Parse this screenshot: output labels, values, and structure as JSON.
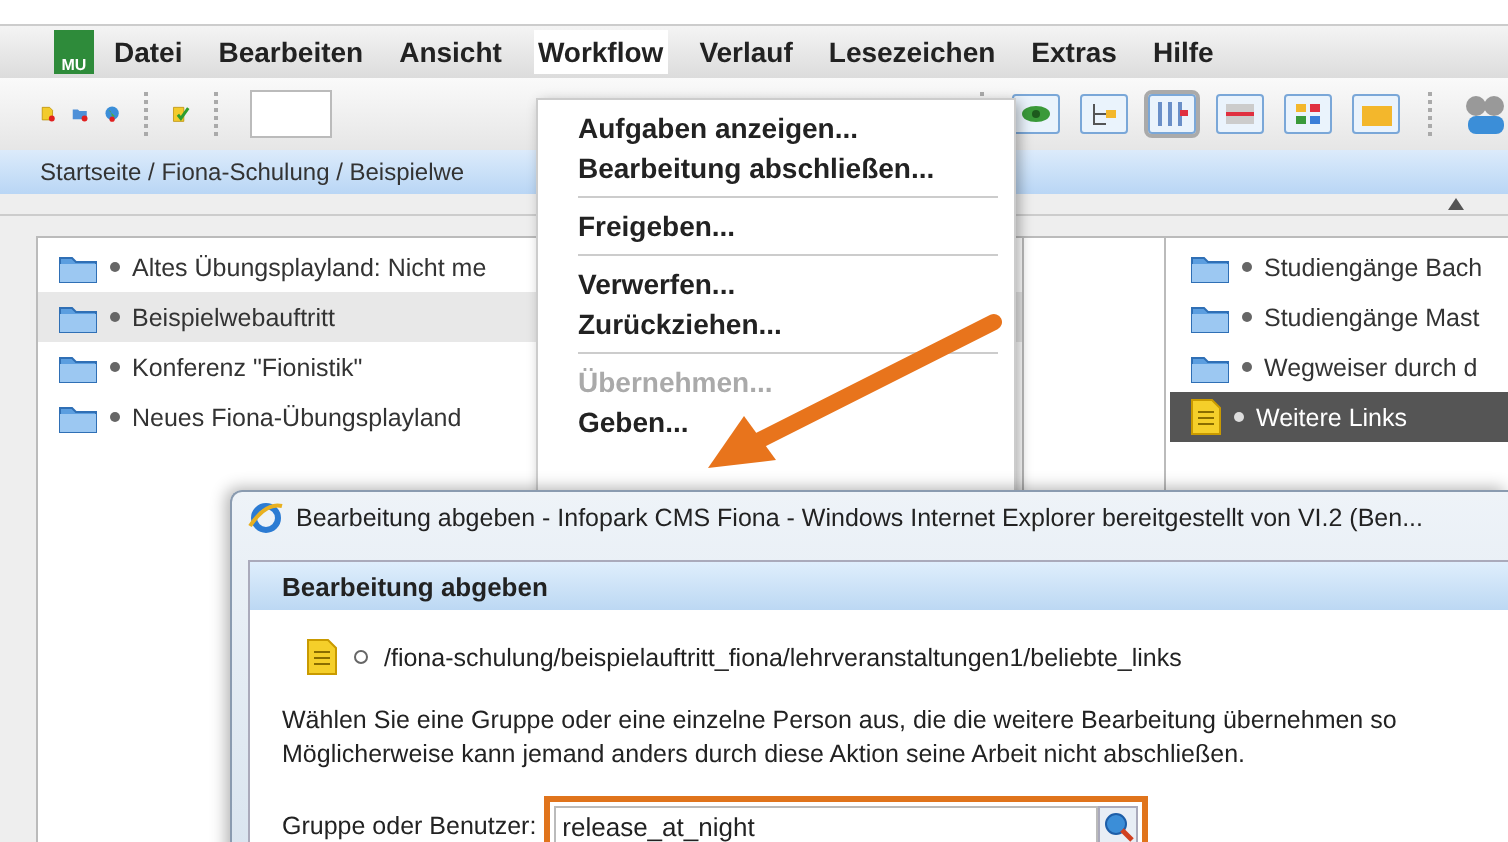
{
  "logo": {
    "text": "MU"
  },
  "menu_bar": {
    "items": [
      {
        "label": "Datei",
        "selected": false
      },
      {
        "label": "Bearbeiten",
        "selected": false
      },
      {
        "label": "Ansicht",
        "selected": false
      },
      {
        "label": "Workflow",
        "selected": true
      },
      {
        "label": "Verlauf",
        "selected": false
      },
      {
        "label": "Lesezeichen",
        "selected": false
      },
      {
        "label": "Extras",
        "selected": false
      },
      {
        "label": "Hilfe",
        "selected": false
      }
    ]
  },
  "breadcrumb": "Startseite / Fiona-Schulung / Beispielwe",
  "left_list": [
    {
      "label": "Altes Übungsplayland: Nicht me",
      "selected": false
    },
    {
      "label": "Beispielwebauftritt",
      "selected": true
    },
    {
      "label": "Konferenz \"Fionistik\"",
      "selected": false
    },
    {
      "label": "Neues Fiona-Übungsplayland",
      "selected": false
    }
  ],
  "right_list": [
    {
      "kind": "folder",
      "label": "Studiengänge Bach",
      "selected": false
    },
    {
      "kind": "folder",
      "label": "Studiengänge Mast",
      "selected": false
    },
    {
      "kind": "folder",
      "label": "Wegweiser durch d",
      "selected": false
    },
    {
      "kind": "document",
      "label": "Weitere Links",
      "selected": true
    }
  ],
  "workflow_menu": {
    "items": [
      {
        "kind": "item",
        "label": "Aufgaben anzeigen...",
        "disabled": false
      },
      {
        "kind": "item",
        "label": "Bearbeitung abschließen...",
        "disabled": false
      },
      {
        "kind": "separator"
      },
      {
        "kind": "item",
        "label": "Freigeben...",
        "disabled": false
      },
      {
        "kind": "separator"
      },
      {
        "kind": "item",
        "label": "Verwerfen...",
        "disabled": false
      },
      {
        "kind": "item",
        "label": "Zurückziehen...",
        "disabled": false
      },
      {
        "kind": "separator"
      },
      {
        "kind": "item",
        "label": "Übernehmen...",
        "disabled": true
      },
      {
        "kind": "item",
        "label": "Geben...",
        "disabled": false
      }
    ]
  },
  "dialog": {
    "title": "Bearbeitung abgeben - Infopark CMS Fiona - Windows Internet Explorer bereitgestellt von VI.2 (Ben...",
    "heading": "Bearbeitung abgeben",
    "path": "/fiona-schulung/beispielauftritt_fiona/lehrveranstaltungen1/beliebte_links",
    "message_lines": [
      "Wählen Sie eine Gruppe oder eine einzelne Person aus, die die weitere Bearbeitung übernehmen so",
      "Möglicherweise kann jemand anders durch diese Aktion seine Arbeit nicht abschließen."
    ],
    "field_label": "Gruppe oder Benutzer:",
    "field_value": "release_at_night"
  }
}
